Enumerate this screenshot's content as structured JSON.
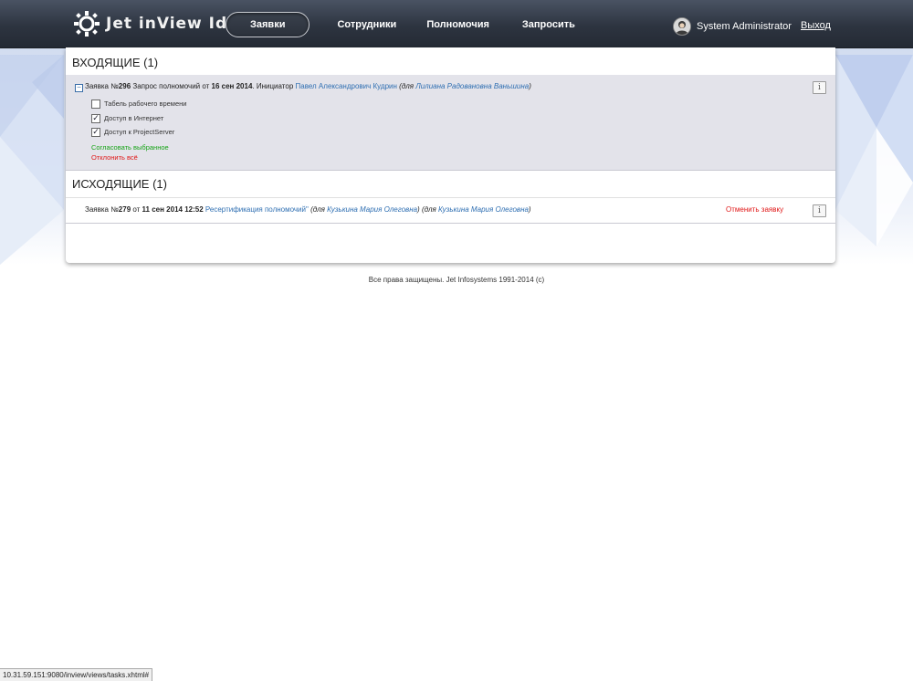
{
  "header": {
    "logo_text": "Jet inView IdM",
    "nav": [
      {
        "label": "Заявки",
        "active": true
      },
      {
        "label": "Сотрудники",
        "active": false
      },
      {
        "label": "Полномочия",
        "active": false
      },
      {
        "label": "Запросить",
        "active": false
      }
    ],
    "user_name": "System Administrator",
    "logout_label": "Выход"
  },
  "incoming": {
    "title": "ВХОДЯЩИЕ (1)",
    "request": {
      "prefix": "Заявка №",
      "number": "296",
      "type_text": " Запрос полномочий от ",
      "date": "16 сен 2014",
      "initiator_label": ". Инициатор ",
      "initiator": "Павел Александрович Кудрин",
      "for_prefix": "(для ",
      "for_name": "Лилиана Радовановна Ваньшина",
      "for_suffix": ")"
    },
    "items": [
      {
        "label": "Табель рабочего времени",
        "checked": false
      },
      {
        "label": "Доступ в Интернет",
        "checked": true
      },
      {
        "label": "Доступ к ProjectServer",
        "checked": true
      }
    ],
    "approve_label": "Согласовать выбранное",
    "reject_label": "Отклонить всё",
    "info_label": "i"
  },
  "outgoing": {
    "title": "ИСХОДЯЩИЕ (1)",
    "request": {
      "prefix": "Заявка №",
      "number": "279",
      "from_text": " от ",
      "datetime": "11 сен 2014 12:52",
      "type_link": "Ресертификация полномочий\"",
      "for1_prefix": "(для ",
      "for1_name": "Кузькина Мария Олеговна",
      "for1_suffix": ")",
      "for2_prefix": "(для ",
      "for2_name": "Кузькина Мария Олеговна",
      "for2_suffix": ")"
    },
    "cancel_label": "Отменить заявку",
    "info_label": "i"
  },
  "footer": "Все права защищены. Jet Infosystems 1991-2014 (c)",
  "status_url": "10.31.59.151:9080/inview/views/tasks.xhtml#",
  "colors": {
    "link": "#2f6fb2",
    "approve": "#17a317",
    "reject": "#e01818",
    "header": "#2d3440"
  }
}
